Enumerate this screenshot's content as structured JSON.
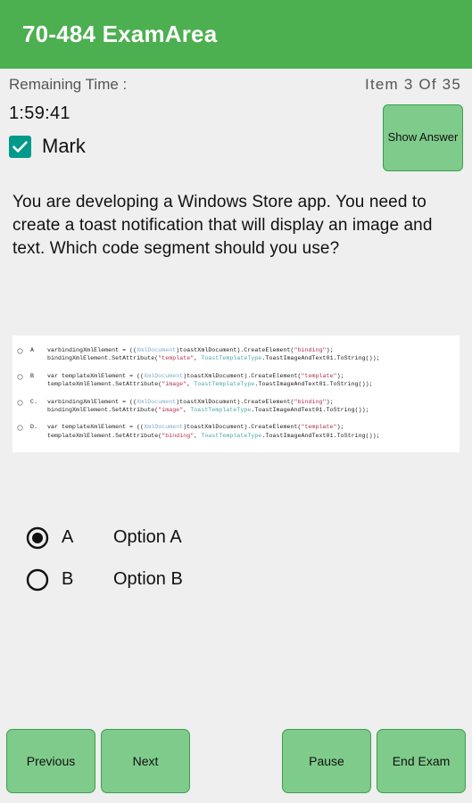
{
  "header": {
    "title": "70-484 ExamArea"
  },
  "status": {
    "remaining_label": "Remaining Time :",
    "timer": "1:59:41",
    "item_counter": "Item 3 Of 35",
    "mark_label": "Mark",
    "mark_checked": true,
    "show_answer_label": "Show Answer"
  },
  "question": {
    "text": "You are developing a Windows Store app. You need to create a toast notification that will display an image and text. Which code segment should you use?"
  },
  "code_options": [
    {
      "letter": "A",
      "line1_a": "varbindingXmlElement = ((",
      "line1_type": "XmlDocument",
      "line1_b": ")toastXmlDocument).CreateElement(",
      "line1_str": "\"binding\"",
      "line1_c": ");",
      "line2_a": "bindingXmlElement.SetAttribute(",
      "line2_str": "\"template\"",
      "line2_b": ", ",
      "line2_class": "ToastTemplateType",
      "line2_c": ".ToastImageAndText01.ToString());"
    },
    {
      "letter": "B",
      "line1_a": "var templateXmlElement = ((",
      "line1_type": "XmlDocument",
      "line1_b": ")toastXmlDocument).CreateElement(",
      "line1_str": "\"template\"",
      "line1_c": ");",
      "line2_a": "templateXmlElement.SetAttribute(",
      "line2_str": "\"image\"",
      "line2_b": ", ",
      "line2_class": "ToastTemplateType",
      "line2_c": ".ToastImageAndText01.ToString());"
    },
    {
      "letter": "C.",
      "line1_a": "varbindingXmlElement = ((",
      "line1_type": "XmlDocument",
      "line1_b": ")toastXmlDocument).CreateElement(",
      "line1_str": "\"binding\"",
      "line1_c": ");",
      "line2_a": "bindingXmlElement.SetAttribute(",
      "line2_str": "\"image\"",
      "line2_b": ", ",
      "line2_class": "ToastTemplateType",
      "line2_c": ".ToastImageAndText01.ToString());"
    },
    {
      "letter": "D.",
      "line1_a": "var templateXmlElement = ((",
      "line1_type": "XmlDocument",
      "line1_b": ")toastXmlDocument).CreateElement(",
      "line1_str": "\"template\"",
      "line1_c": ");",
      "line2_a": "templateXmlElement.SetAttribute(",
      "line2_str": "\"binding\"",
      "line2_b": ", ",
      "line2_class": "ToastTemplateType",
      "line2_c": ".ToastImageAndText01.ToString());"
    }
  ],
  "answers": [
    {
      "letter": "A",
      "label": "Option A",
      "selected": true
    },
    {
      "letter": "B",
      "label": "Option B",
      "selected": false
    }
  ],
  "bottom_bar": {
    "previous": "Previous",
    "next": "Next",
    "pause": "Pause",
    "end_exam": "End Exam"
  },
  "colors": {
    "header_green": "#4CAF50",
    "button_green": "#7FCB8B",
    "button_border": "#3E9E4E",
    "checkbox_teal": "#00998A",
    "page_background": "#EFEFEF"
  }
}
